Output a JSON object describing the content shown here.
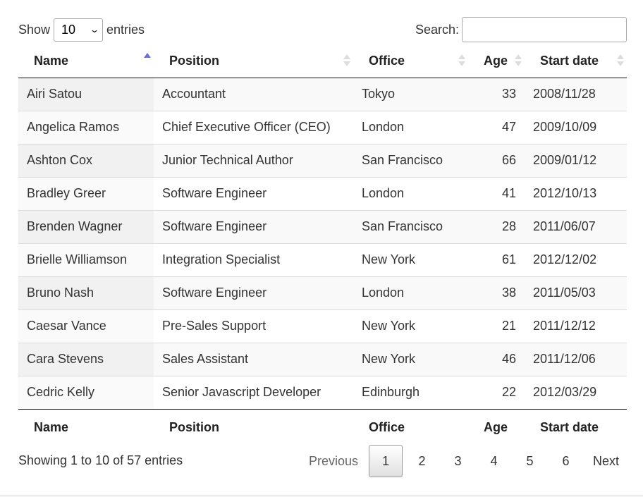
{
  "length": {
    "show_label": "Show",
    "value": "10",
    "entries_label": "entries"
  },
  "search": {
    "label": "Search:",
    "value": ""
  },
  "columns": [
    "Name",
    "Position",
    "Office",
    "Age",
    "Start date"
  ],
  "rows": [
    {
      "name": "Airi Satou",
      "position": "Accountant",
      "office": "Tokyo",
      "age": "33",
      "start": "2008/11/28"
    },
    {
      "name": "Angelica Ramos",
      "position": "Chief Executive Officer (CEO)",
      "office": "London",
      "age": "47",
      "start": "2009/10/09"
    },
    {
      "name": "Ashton Cox",
      "position": "Junior Technical Author",
      "office": "San Francisco",
      "age": "66",
      "start": "2009/01/12"
    },
    {
      "name": "Bradley Greer",
      "position": "Software Engineer",
      "office": "London",
      "age": "41",
      "start": "2012/10/13"
    },
    {
      "name": "Brenden Wagner",
      "position": "Software Engineer",
      "office": "San Francisco",
      "age": "28",
      "start": "2011/06/07"
    },
    {
      "name": "Brielle Williamson",
      "position": "Integration Specialist",
      "office": "New York",
      "age": "61",
      "start": "2012/12/02"
    },
    {
      "name": "Bruno Nash",
      "position": "Software Engineer",
      "office": "London",
      "age": "38",
      "start": "2011/05/03"
    },
    {
      "name": "Caesar Vance",
      "position": "Pre-Sales Support",
      "office": "New York",
      "age": "21",
      "start": "2011/12/12"
    },
    {
      "name": "Cara Stevens",
      "position": "Sales Assistant",
      "office": "New York",
      "age": "46",
      "start": "2011/12/06"
    },
    {
      "name": "Cedric Kelly",
      "position": "Senior Javascript Developer",
      "office": "Edinburgh",
      "age": "22",
      "start": "2012/03/29"
    }
  ],
  "info": "Showing 1 to 10 of 57 entries",
  "pagination": {
    "previous": "Previous",
    "pages": [
      "1",
      "2",
      "3",
      "4",
      "5",
      "6"
    ],
    "current": "1",
    "next": "Next"
  },
  "colors": {
    "sort_active": "#6b6ed8",
    "sort_inactive": "#dddddd"
  },
  "icons": {
    "select_arrow": "chevron-down-icon",
    "sort": "sort-arrows-icon"
  }
}
